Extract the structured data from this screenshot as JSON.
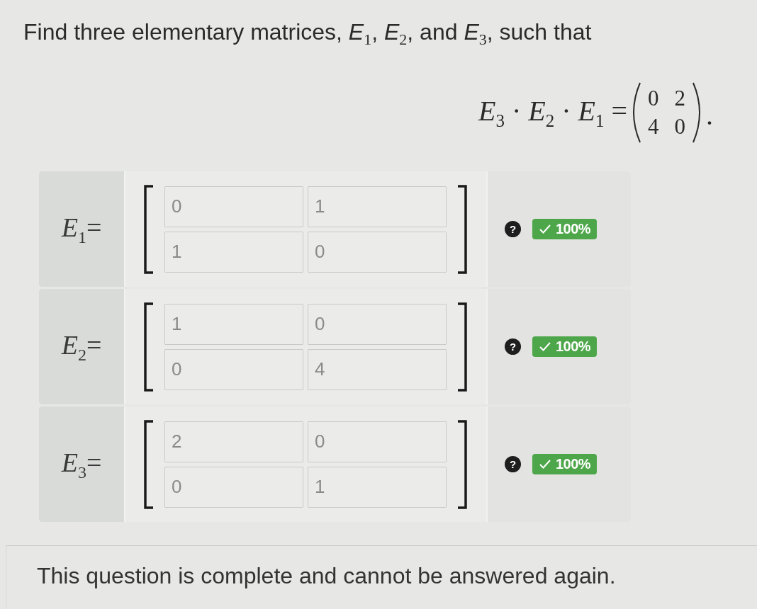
{
  "question": {
    "prompt": "Find three elementary matrices, *E*$_{1}$, *E*$_{2}$, and *E*$_{3}$, such that"
  },
  "equation": {
    "lhs": "*E*$_{3}$ · *E*$_{2}$ · *E*$_{1}$ =",
    "matrix": [
      [
        "0",
        "2"
      ],
      [
        "4",
        "0"
      ]
    ],
    "terminator": "."
  },
  "answers": [
    {
      "label": "*E*$_{1}$=",
      "entries": [
        [
          "0",
          "1"
        ],
        [
          "1",
          "0"
        ]
      ],
      "help": "?",
      "correct": true,
      "score": "100%"
    },
    {
      "label": "*E*$_{2}$=",
      "entries": [
        [
          "1",
          "0"
        ],
        [
          "0",
          "4"
        ]
      ],
      "help": "?",
      "correct": true,
      "score": "100%"
    },
    {
      "label": "*E*$_{3}$=",
      "entries": [
        [
          "2",
          "0"
        ],
        [
          "0",
          "1"
        ]
      ],
      "help": "?",
      "correct": true,
      "score": "100%"
    }
  ],
  "status": {
    "message": "This question is complete and cannot be answered again."
  }
}
